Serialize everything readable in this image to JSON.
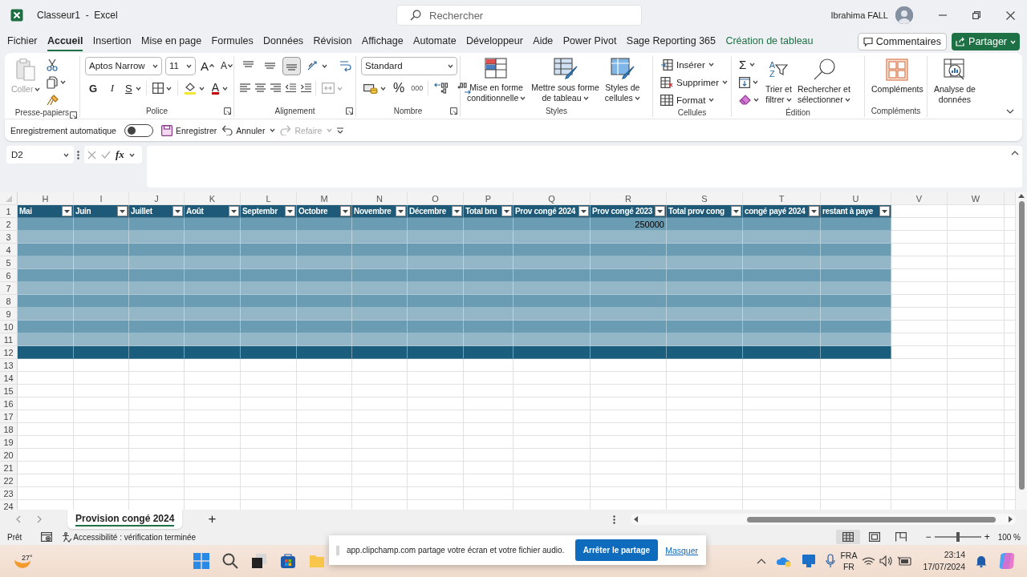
{
  "window": {
    "title": "Classeur1  -  Excel",
    "user": "Ibrahima FALL"
  },
  "search": {
    "placeholder": "Rechercher"
  },
  "menu_tabs": [
    {
      "label": "Fichier",
      "selected": false,
      "contextual": false
    },
    {
      "label": "Accueil",
      "selected": true,
      "contextual": false
    },
    {
      "label": "Insertion",
      "selected": false,
      "contextual": false
    },
    {
      "label": "Mise en page",
      "selected": false,
      "contextual": false
    },
    {
      "label": "Formules",
      "selected": false,
      "contextual": false
    },
    {
      "label": "Données",
      "selected": false,
      "contextual": false
    },
    {
      "label": "Révision",
      "selected": false,
      "contextual": false
    },
    {
      "label": "Affichage",
      "selected": false,
      "contextual": false
    },
    {
      "label": "Automate",
      "selected": false,
      "contextual": false
    },
    {
      "label": "Développeur",
      "selected": false,
      "contextual": false
    },
    {
      "label": "Aide",
      "selected": false,
      "contextual": false
    },
    {
      "label": "Power Pivot",
      "selected": false,
      "contextual": false
    },
    {
      "label": "Sage Reporting 365",
      "selected": false,
      "contextual": false
    },
    {
      "label": "Création de tableau",
      "selected": false,
      "contextual": true
    }
  ],
  "comments_button": "Commentaires",
  "share_button": "Partager",
  "ribbon": [
    {
      "kind": "clipboard",
      "label": "Presse-papiers",
      "launcher": true,
      "paste": {
        "label": "Coller",
        "disabled": true
      }
    },
    {
      "kind": "font",
      "label": "Police",
      "launcher": true,
      "font": "Aptos Narrow",
      "size": "11",
      "grow": "A",
      "shrink": "A",
      "bold": "G",
      "italic": "I",
      "underline": "S",
      "font_color": "A"
    },
    {
      "kind": "alignment",
      "label": "Alignement",
      "launcher": true,
      "vertical": [
        {
          "selected": false
        },
        {
          "selected": false
        },
        {
          "selected": true
        }
      ],
      "merge": {
        "disabled": true
      }
    },
    {
      "kind": "number",
      "label": "Nombre",
      "launcher": true,
      "format": "Standard",
      "percent": "%",
      "thousands": "000"
    },
    {
      "kind": "styles",
      "label": "Styles",
      "launcher": false,
      "buttons": [
        [
          "Mise en forme",
          "conditionnelle"
        ],
        [
          "Mettre sous forme",
          "de tableau"
        ],
        [
          "Styles de",
          "cellules"
        ]
      ]
    },
    {
      "kind": "cells",
      "label": "Cellules",
      "launcher": false,
      "buttons": [
        "Insérer",
        "Supprimer",
        "Format"
      ]
    },
    {
      "kind": "editing",
      "label": "Édition",
      "launcher": false,
      "sum": "Σ",
      "sort_letters": [
        "A",
        "Z"
      ],
      "buttons": [
        [
          "Trier et",
          "filtrer"
        ],
        [
          "Rechercher et",
          "sélectionner"
        ]
      ]
    },
    {
      "kind": "addins",
      "label": "Compléments",
      "launcher": false,
      "buttons": [
        [
          "Compléments"
        ]
      ]
    },
    {
      "kind": "analysis",
      "launcher": false,
      "buttons": [
        [
          "Analyse de",
          "données"
        ]
      ]
    }
  ],
  "quick_access": {
    "autosave": {
      "label": "Enregistrement automatique",
      "on": false
    },
    "save": {
      "label": "Enregistrer"
    },
    "undo": {
      "label": "Annuler",
      "disabled": false
    },
    "redo": {
      "label": "Refaire",
      "disabled": true
    }
  },
  "formula_bar": {
    "name_box": "D2",
    "function_label": "fx"
  },
  "sheet": {
    "columns": [
      "H",
      "I",
      "J",
      "K",
      "L",
      "M",
      "N",
      "O",
      "P",
      "Q",
      "R",
      "S",
      "T",
      "U",
      "V",
      "W"
    ],
    "row_numbers": [
      "1",
      "2",
      "3",
      "4",
      "5",
      "6",
      "7",
      "8",
      "9",
      "10",
      "11",
      "12",
      "13",
      "14",
      "15",
      "16",
      "17",
      "18",
      "19",
      "20",
      "21",
      "22",
      "23",
      "24"
    ],
    "table": {
      "headers": [
        "Mai",
        "Juin",
        "Juillet",
        "Août",
        "Septembr",
        "Octobre",
        "Novembre",
        "Décembre",
        "Total bru",
        "Prov congé 2024",
        "Prov congé 2023",
        "Total prov cong",
        "congé payé 2024",
        "restant à paye"
      ],
      "rows": [
        {
          "kind": "data",
          "values": {
            "R": "250000"
          }
        },
        {
          "kind": "data"
        },
        {
          "kind": "data"
        },
        {
          "kind": "data"
        },
        {
          "kind": "data"
        },
        {
          "kind": "data"
        },
        {
          "kind": "data"
        },
        {
          "kind": "data"
        },
        {
          "kind": "data"
        },
        {
          "kind": "data"
        },
        {
          "kind": "total"
        }
      ]
    }
  },
  "sheet_tabs": [
    {
      "label": "Provision congé 2024",
      "selected": true
    }
  ],
  "add_sheet": "+",
  "status_bar": {
    "ready": "Prêt",
    "accessibility": "Accessibilité : vérification terminée",
    "views": [
      {
        "kind": "normal",
        "selected": true
      },
      {
        "kind": "page_layout",
        "selected": false
      },
      {
        "kind": "page_break",
        "selected": false
      }
    ],
    "zoom": {
      "minus": "−",
      "plus": "+",
      "level": 0.5,
      "reading": "100 %"
    }
  },
  "taskbar": {
    "weather": "27°",
    "language": "FRA",
    "layout": "FR",
    "time": "23:14",
    "date": "17/07/2024"
  },
  "notification": {
    "message": "app.clipchamp.com partage votre écran et votre fichier audio.",
    "stop_button": "Arrêter le partage",
    "hide_link": "Masquer"
  }
}
